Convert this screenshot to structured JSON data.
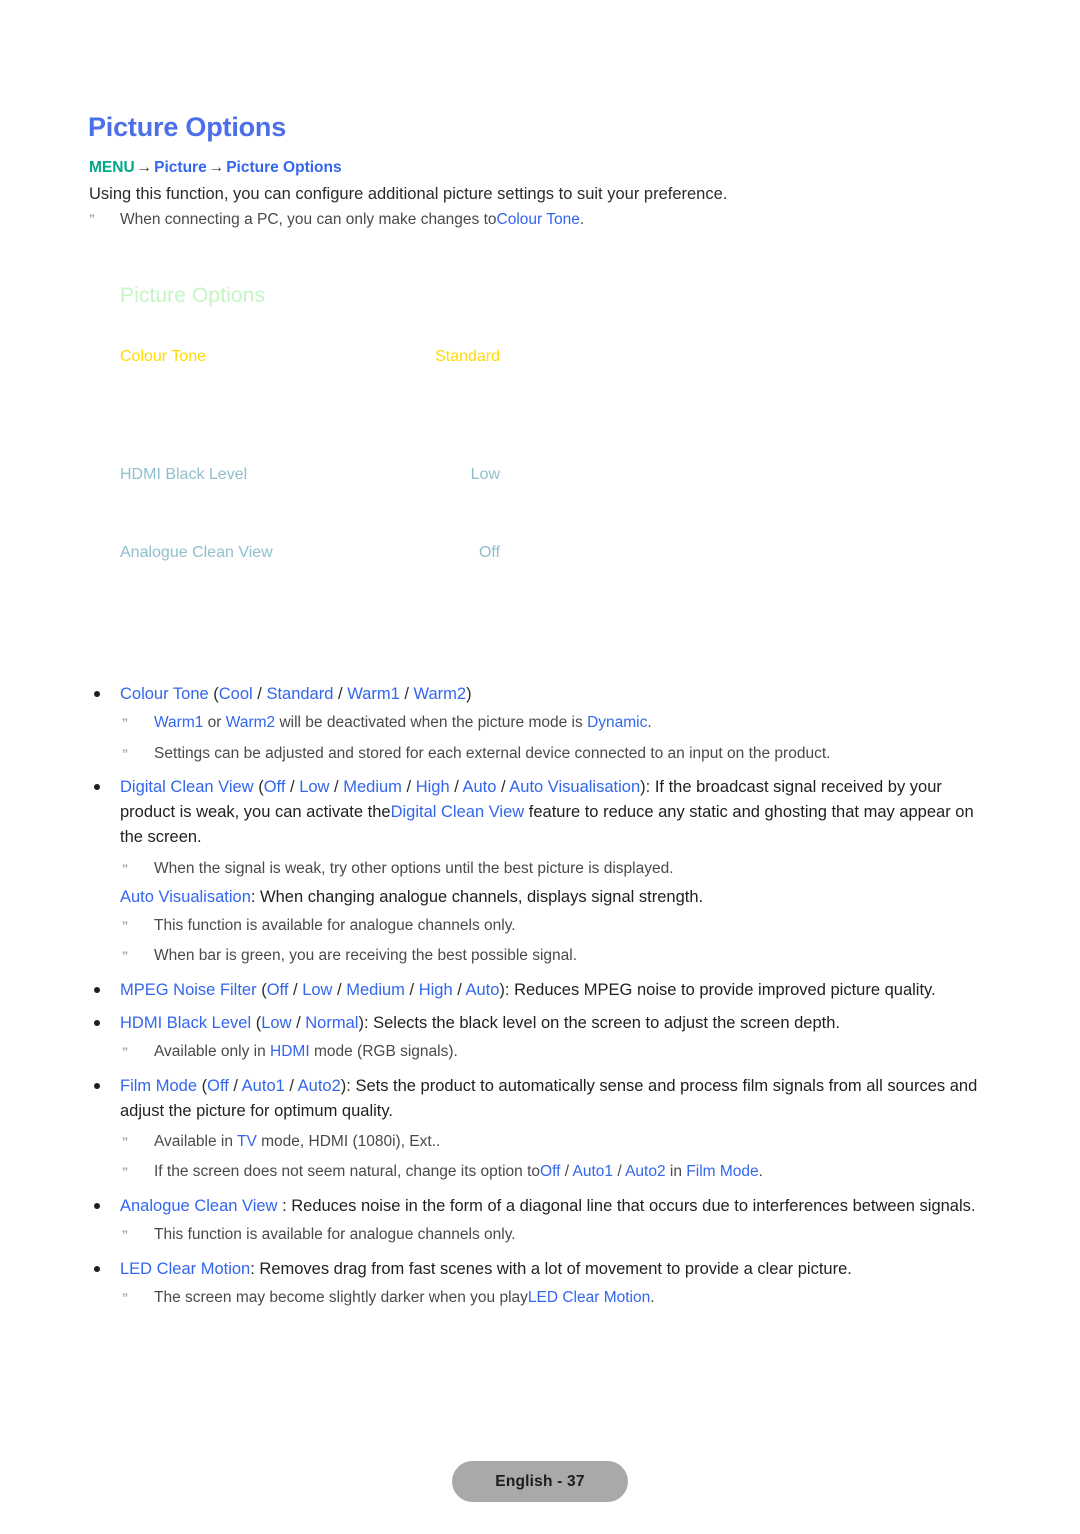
{
  "page": {
    "title": "Picture Options",
    "breadcrumb": {
      "menu": "MENU",
      "arrow": "→",
      "step1": "Picture",
      "step2": "Picture Options"
    },
    "intro": "Using this function, you can configure additional picture settings to suit your preference.",
    "note_marker": "ˮ",
    "intro_note": {
      "text_before": "When connecting a PC, you can only make changes to",
      "link": "Colour Tone",
      "text_after": "."
    }
  },
  "menu_mock": {
    "heading": "Picture Options",
    "rows": [
      {
        "label": "Colour Tone",
        "value": "Standard",
        "state": "selected"
      },
      {
        "label": "HDMI Black Level",
        "value": "Low",
        "state": "normal"
      },
      {
        "label": "Analogue Clean View",
        "value": "Off",
        "state": "normal"
      }
    ]
  },
  "colors": {
    "title_blue": "#4b6fe8",
    "menu_teal": "#00a887",
    "link_blue": "#3366ee",
    "menu_heading_green": "#c4f5c4",
    "menu_selected_yellow": "#ffd900",
    "menu_normal_blue": "#8fbfcc",
    "footer_pill_gray": "#a9a9a9",
    "body_text": "#1f1f1f",
    "note_text": "#4a4a4a"
  },
  "content": {
    "b1": {
      "name": "Colour Tone",
      "open": " (",
      "opt1": "Cool",
      "sep": " / ",
      "opt2": "Standard",
      "opt3": "Warm1",
      "opt4": "Warm2",
      "close": ")"
    },
    "b1n1": {
      "p1": "Warm1",
      "p2": " or ",
      "p3": "Warm2",
      "p4": " will be deactivated when the picture mode is ",
      "p5": "Dynamic",
      "p6": "."
    },
    "b1n2": "Settings can be adjusted and stored for each external device connected to an input on the product.",
    "b2": {
      "name": "Digital Clean View",
      "open": " (",
      "opt1": "Off",
      "sep": " / ",
      "opt2": "Low",
      "opt3": "Medium",
      "opt4": "High",
      "opt5": "Auto",
      "opt6": "Auto Visualisation",
      "close": "): ",
      "body1": "If the broadcast signal received by your product is weak, you can activate the",
      "link2": "Digital Clean View",
      "body2": " feature to reduce any static and ghosting that may appear on the screen."
    },
    "b2n1": "When the signal is weak, try other options until the best picture is displayed.",
    "b2p": {
      "link": "Auto Visualisation",
      "text": ": When changing analogue channels, displays signal strength."
    },
    "b2n2": "This function is available for analogue channels only.",
    "b2n3": "When bar is green, you are receiving the best possible signal.",
    "b3": {
      "name": "MPEG Noise Filter",
      "open": " (",
      "opt1": "Off",
      "sep": " / ",
      "opt2": "Low",
      "opt3": "Medium",
      "opt4": "High",
      "opt5": "Auto",
      "close": "): ",
      "body": "Reduces MPEG noise to provide improved picture quality."
    },
    "b4": {
      "name": "HDMI Black Level",
      "open": " (",
      "opt1": "Low",
      "sep": " / ",
      "opt2": "Normal",
      "close": "): ",
      "body": "Selects the black level on the screen to adjust the screen depth."
    },
    "b4n1": {
      "p1": "Available only in ",
      "p2": "HDMI",
      "p3": " mode (RGB signals)."
    },
    "b5": {
      "name": "Film Mode",
      "open": " (",
      "opt1": "Off",
      "sep": " / ",
      "opt2": "Auto1",
      "opt3": "Auto2",
      "close": "): ",
      "body": "Sets the product to automatically sense and process film signals from all sources and adjust the picture for optimum quality."
    },
    "b5n1": {
      "p1": "Available in ",
      "p2": "TV",
      "p3": " mode, HDMI (1080i), Ext.."
    },
    "b5n2": {
      "p1": "If the screen does not seem natural, change its option to",
      "p2": "Off",
      "sep": " / ",
      "p3": "Auto1",
      "p4": "Auto2",
      "p5": " in ",
      "p6": "Film Mode",
      "p7": "."
    },
    "b6": {
      "name": "Analogue Clean View",
      "body": " : Reduces noise in the form of a diagonal line that occurs due to interferences between signals."
    },
    "b6n1": "This function is available for analogue channels only.",
    "b7": {
      "name": "LED Clear Motion",
      "body": ": Removes drag from fast scenes with a lot of movement to provide a clear picture."
    },
    "b7n1": {
      "p1": "The screen may become slightly darker when you play",
      "p2": "LED Clear Motion",
      "p3": "."
    }
  },
  "footer": {
    "label": "English - 37"
  }
}
